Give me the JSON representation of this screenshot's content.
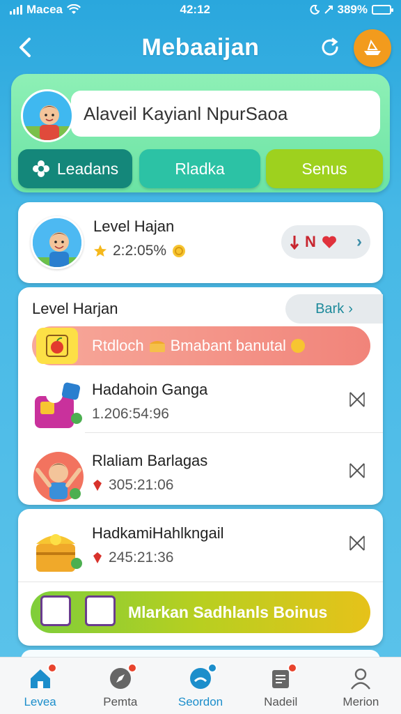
{
  "status_bar": {
    "carrier": "Macea",
    "time": "42:12",
    "battery": "389%"
  },
  "header": {
    "title": "Mebaaijan"
  },
  "profile": {
    "name_value": "Alaveil Kayianl  NpurSaoa",
    "tabs": [
      {
        "label": "Leadans"
      },
      {
        "label": "Rladka"
      },
      {
        "label": "Senus"
      }
    ]
  },
  "level_card": {
    "title": "Level Hajan",
    "score": "2:2:05%",
    "pill_text": "N"
  },
  "list_card": {
    "heading": "Level Harjan",
    "back_label": "Bark",
    "banner": {
      "word1": "Rtdloch",
      "word2": "Bmabant banutal"
    },
    "items": [
      {
        "title": "Hadahoin Ganga",
        "value": "1.206:54:96"
      },
      {
        "title": "Rlaliam Barlagas",
        "value": "305:21:06"
      }
    ]
  },
  "third_card": {
    "item": {
      "title": "HadkamiHahlkngail",
      "value": "245:21:36"
    },
    "bonus_label": "Mlarkan Sadhlanls Boinus"
  },
  "bottom_nav": [
    {
      "label": "Levea"
    },
    {
      "label": "Pemta"
    },
    {
      "label": "Seordon"
    },
    {
      "label": "Nadeil"
    },
    {
      "label": "Merion"
    }
  ],
  "colors": {
    "background": "#2aa7dd",
    "profile_card": "#7ee9ae",
    "tab_dark": "#14877a",
    "tab_mid": "#2cc2a5",
    "tab_lime": "#9ed11e",
    "banner_red": "#f1847a",
    "active_nav": "#1c8ecb"
  }
}
